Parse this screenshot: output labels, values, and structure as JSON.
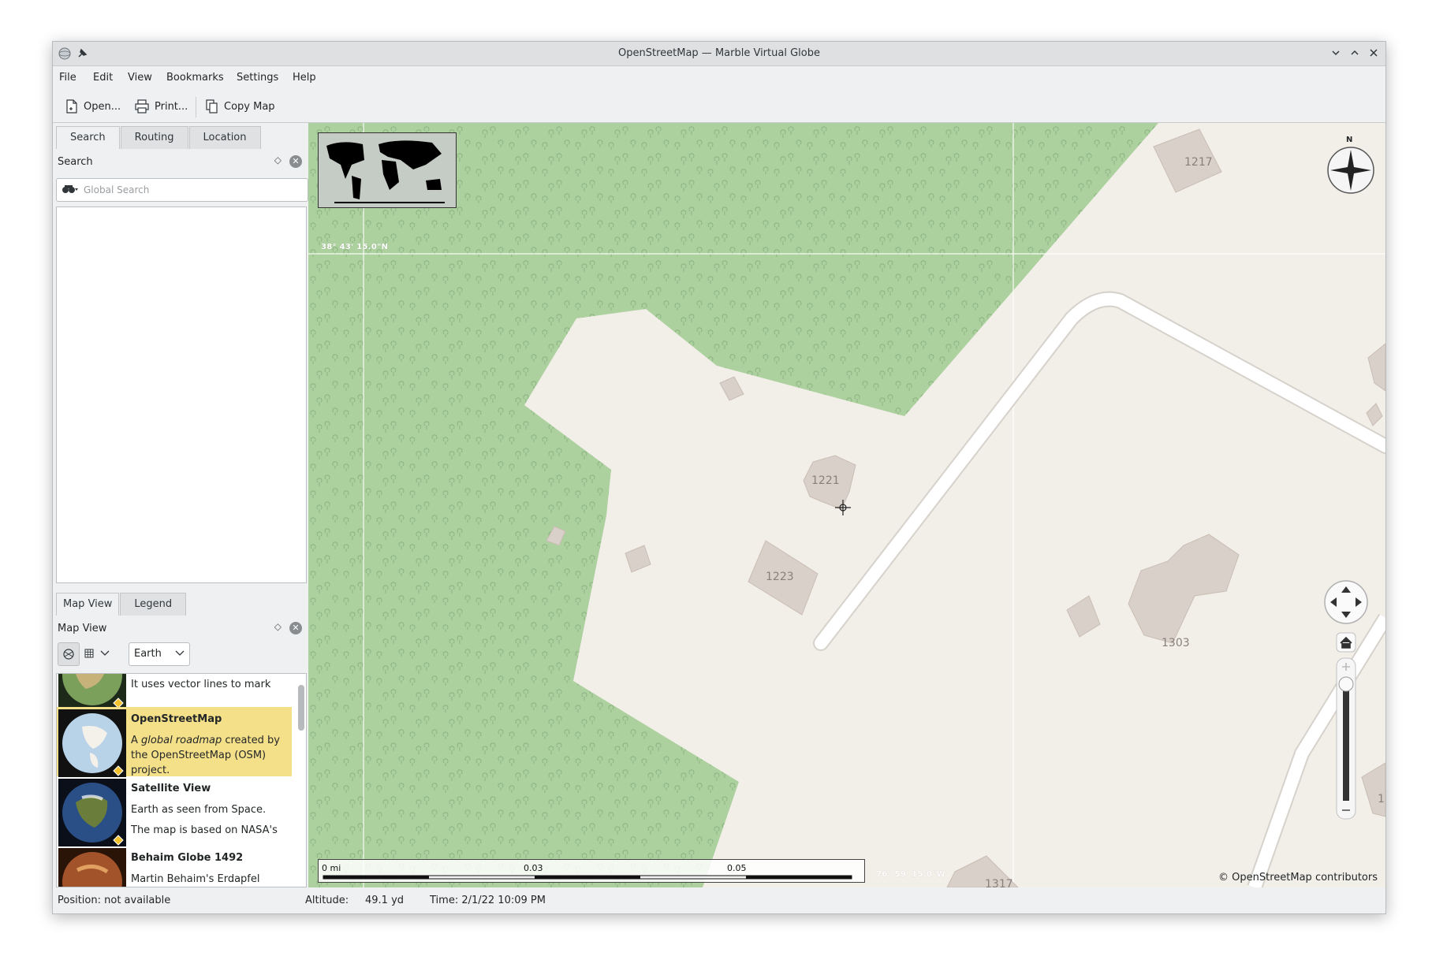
{
  "window": {
    "title": "OpenStreetMap — Marble Virtual Globe"
  },
  "menu": [
    "File",
    "Edit",
    "View",
    "Bookmarks",
    "Settings",
    "Help"
  ],
  "toolbar": {
    "open_label": "Open...",
    "print_label": "Print...",
    "copy_map_label": "Copy Map"
  },
  "left_tabs": [
    "Search",
    "Routing",
    "Location"
  ],
  "search_dock": {
    "title": "Search",
    "placeholder": "Global Search",
    "value": ""
  },
  "bottom_tabs": [
    "Map View",
    "Legend"
  ],
  "mapview_dock": {
    "title": "Map View",
    "celestial_body": "Earth"
  },
  "themes": [
    {
      "name": "",
      "description": "A classic topographic map. It uses vector lines to mark",
      "selected": false
    },
    {
      "name": "OpenStreetMap",
      "description_parts": [
        "A ",
        "global roadmap",
        " created by the OpenStreetMap (OSM) project."
      ],
      "selected": true
    },
    {
      "name": "Satellite View",
      "description": "Earth as seen from Space.",
      "description2": "The map is based on NASA's",
      "selected": false
    },
    {
      "name": "Behaim Globe 1492",
      "description": "Martin Behaim's Erdapfel",
      "selected": false
    }
  ],
  "map": {
    "lat_label": "38° 43' 15.0\"N",
    "lon_label": "76° 59' 15.0\"W",
    "house_numbers": [
      "1217",
      "1221",
      "1223",
      "1303",
      "1317",
      "1"
    ],
    "compass_north": "N",
    "scale": {
      "labels": [
        "0 mi",
        "0.03",
        "0.05"
      ]
    },
    "attribution": "© OpenStreetMap contributors",
    "colors": {
      "wood": "#add19e",
      "landuse": "#f2efe9",
      "building": "#d9d0c9",
      "road": "#ffffff"
    }
  },
  "status": {
    "position": "Position: not available",
    "altitude_label": "Altitude:",
    "altitude_value": "49.1 yd",
    "time": "Time: 2/1/22 10:09 PM"
  }
}
